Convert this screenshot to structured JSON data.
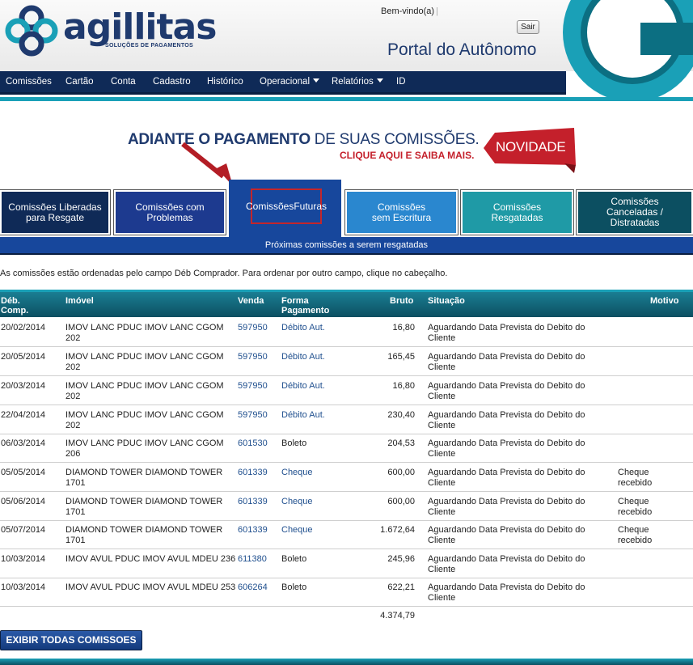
{
  "header": {
    "brand": "agillitas",
    "brand_sub": "SOLUÇÕES DE PAGAMENTOS",
    "welcome": "Bem-vindo(a)",
    "welcome_sep": "|",
    "logout_label": "Sair",
    "portal_title": "Portal do Autônomo"
  },
  "nav": {
    "items": [
      {
        "label": "Comissões",
        "has_menu": false
      },
      {
        "label": "Cartão",
        "has_menu": false
      },
      {
        "label": "Conta",
        "has_menu": false
      },
      {
        "label": "Cadastro",
        "has_menu": false
      },
      {
        "label": "Histórico",
        "has_menu": false
      },
      {
        "label": "Operacional",
        "has_menu": true
      },
      {
        "label": "Relatórios",
        "has_menu": true
      },
      {
        "label": "ID",
        "has_menu": false
      }
    ]
  },
  "banner": {
    "main_bold": "ADIANTE O PAGAMENTO",
    "main_rest": " DE SUAS COMISSÕES.",
    "sub": "CLIQUE AQUI E SAIBA MAIS.",
    "badge": "NOVIDADE"
  },
  "tabs": [
    {
      "line1": "Comissões Liberadas",
      "line2": "para Resgate",
      "color": "#0f2a57"
    },
    {
      "line1": "Comissões com",
      "line2": "Problemas",
      "color": "#1d3a8f"
    },
    {
      "line1": "Comissões",
      "line2": "Futuras",
      "color": "#17479c",
      "active": true
    },
    {
      "line1": "Comissões",
      "line2": "sem Escritura",
      "color": "#2a87cf"
    },
    {
      "line1": "Comissões",
      "line2": "Resgatadas",
      "color": "#1f9aa6"
    },
    {
      "line1": "Comissões",
      "line2": "Canceladas /",
      "line3": "Distratadas",
      "color": "#0c4f61"
    }
  ],
  "subbar": "Próximas comissões a serem resgatadas",
  "info": "As comissões estão ordenadas pelo campo Déb Comprador. Para ordenar por outro campo, clique no cabeçalho.",
  "table": {
    "headers": {
      "deb": "Déb.",
      "deb2": "Comp.",
      "imovel": "Imóvel",
      "venda": "Venda",
      "forma": "Forma",
      "forma2": "Pagamento",
      "bruto": "Bruto",
      "situacao": "Situação",
      "motivo": "Motivo"
    },
    "rows": [
      {
        "deb": "20/02/2014",
        "im1": "IMOV LANC PDUC IMOV LANC CGOM",
        "im2": "202",
        "venda": "597950",
        "forma": "Débito Aut.",
        "forma_link": true,
        "bruto": "16,80",
        "sit1": "Aguardando Data Prevista do Debito do",
        "sit2": "Cliente",
        "mot1": "",
        "mot2": ""
      },
      {
        "deb": "20/05/2014",
        "im1": "IMOV LANC PDUC IMOV LANC CGOM",
        "im2": "202",
        "venda": "597950",
        "forma": "Débito Aut.",
        "forma_link": true,
        "bruto": "165,45",
        "sit1": "Aguardando Data Prevista do Debito do",
        "sit2": "Cliente",
        "mot1": "",
        "mot2": ""
      },
      {
        "deb": "20/03/2014",
        "im1": "IMOV LANC PDUC IMOV LANC CGOM",
        "im2": "202",
        "venda": "597950",
        "forma": "Débito Aut.",
        "forma_link": true,
        "bruto": "16,80",
        "sit1": "Aguardando Data Prevista do Debito do",
        "sit2": "Cliente",
        "mot1": "",
        "mot2": ""
      },
      {
        "deb": "22/04/2014",
        "im1": "IMOV LANC PDUC IMOV LANC CGOM",
        "im2": "202",
        "venda": "597950",
        "forma": "Débito Aut.",
        "forma_link": true,
        "bruto": "230,40",
        "sit1": "Aguardando Data Prevista do Debito do",
        "sit2": "Cliente",
        "mot1": "",
        "mot2": ""
      },
      {
        "deb": "06/03/2014",
        "im1": "IMOV LANC PDUC IMOV LANC CGOM",
        "im2": "206",
        "venda": "601530",
        "forma": "Boleto",
        "forma_link": false,
        "bruto": "204,53",
        "sit1": "Aguardando Data Prevista do Debito do",
        "sit2": "Cliente",
        "mot1": "",
        "mot2": ""
      },
      {
        "deb": "05/05/2014",
        "im1": "DIAMOND TOWER DIAMOND TOWER",
        "im2": "1701",
        "venda": "601339",
        "forma": "Cheque",
        "forma_link": true,
        "bruto": "600,00",
        "sit1": "Aguardando Data Prevista do Debito do",
        "sit2": "Cliente",
        "mot1": "Cheque",
        "mot2": "recebido"
      },
      {
        "deb": "05/06/2014",
        "im1": "DIAMOND TOWER DIAMOND TOWER",
        "im2": "1701",
        "venda": "601339",
        "forma": "Cheque",
        "forma_link": true,
        "bruto": "600,00",
        "sit1": "Aguardando Data Prevista do Debito do",
        "sit2": "Cliente",
        "mot1": "Cheque",
        "mot2": "recebido"
      },
      {
        "deb": "05/07/2014",
        "im1": "DIAMOND TOWER DIAMOND TOWER",
        "im2": "1701",
        "venda": "601339",
        "forma": "Cheque",
        "forma_link": true,
        "bruto": "1.672,64",
        "sit1": "Aguardando Data Prevista do Debito do",
        "sit2": "Cliente",
        "mot1": "Cheque",
        "mot2": "recebido"
      },
      {
        "deb": "10/03/2014",
        "im1": "IMOV AVUL PDUC IMOV AVUL MDEU 236",
        "im2": "",
        "venda": "611380",
        "forma": "Boleto",
        "forma_link": false,
        "bruto": "245,96",
        "sit1": "Aguardando Data Prevista do Debito do",
        "sit2": "Cliente",
        "mot1": "",
        "mot2": ""
      },
      {
        "deb": "10/03/2014",
        "im1": "IMOV AVUL PDUC IMOV AVUL MDEU 253",
        "im2": "",
        "venda": "606264",
        "forma": "Boleto",
        "forma_link": false,
        "bruto": "622,21",
        "sit1": "Aguardando Data Prevista do Debito do",
        "sit2": "Cliente",
        "mot1": "",
        "mot2": ""
      }
    ],
    "total": "4.374,79"
  },
  "show_all_label": "EXIBIR TODAS COMISSOES",
  "colors": {
    "navy": "#0f2a57",
    "teal": "#1aa0b7",
    "accent_red": "#c4202b",
    "link": "#1f4f8e"
  }
}
